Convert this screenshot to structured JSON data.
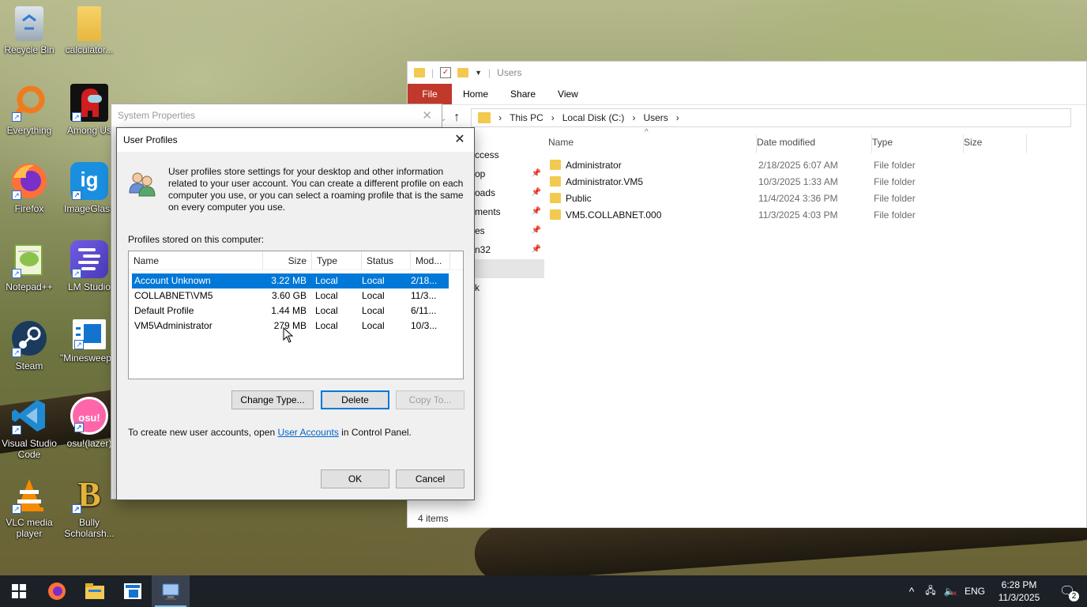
{
  "desktop": {
    "icons": [
      {
        "label": "Recycle Bin"
      },
      {
        "label": "calculator..."
      },
      {
        "label": "Everything"
      },
      {
        "label": "Among Us"
      },
      {
        "label": "Firefox"
      },
      {
        "label": "ImageGlass"
      },
      {
        "label": "Notepad++"
      },
      {
        "label": "LM Studio"
      },
      {
        "label": "Steam"
      },
      {
        "label": "\"Minesweeper"
      },
      {
        "label": "Visual Studio Code"
      },
      {
        "label": "osu!(lazer)"
      },
      {
        "label": "VLC media player"
      },
      {
        "label": "Bully Scholarsh..."
      }
    ]
  },
  "explorer": {
    "title": "Users",
    "tabs": [
      "File",
      "Home",
      "Share",
      "View"
    ],
    "breadcrumb": [
      "This PC",
      "Local Disk (C:)",
      "Users"
    ],
    "nav_items": [
      {
        "label": "ccess",
        "pinned": false
      },
      {
        "label": "op",
        "pinned": true
      },
      {
        "label": "oads",
        "pinned": true
      },
      {
        "label": "ments",
        "pinned": true
      },
      {
        "label": "es",
        "pinned": true
      },
      {
        "label": "n32",
        "pinned": true
      },
      {
        "label": "",
        "pinned": false
      },
      {
        "label": "k",
        "pinned": false
      }
    ],
    "columns": [
      "Name",
      "Date modified",
      "Type",
      "Size"
    ],
    "files": [
      {
        "name": "Administrator",
        "date": "2/18/2025 6:07 AM",
        "type": "File folder"
      },
      {
        "name": "Administrator.VM5",
        "date": "10/3/2025 1:33 AM",
        "type": "File folder"
      },
      {
        "name": "Public",
        "date": "11/4/2024 3:36 PM",
        "type": "File folder"
      },
      {
        "name": "VM5.COLLABNET.000",
        "date": "11/3/2025 4:03 PM",
        "type": "File folder"
      }
    ],
    "status": "4 items"
  },
  "system_properties": {
    "title": "System Properties"
  },
  "user_profiles": {
    "title": "User Profiles",
    "description": "User profiles store settings for your desktop and other information related to your user account. You can create a different profile on each computer you use, or you can select a roaming profile that is the same on every computer you use.",
    "list_label": "Profiles stored on this computer:",
    "columns": [
      "Name",
      "Size",
      "Type",
      "Status",
      "Mod..."
    ],
    "rows": [
      {
        "name": "Account Unknown",
        "size": "3.22 MB",
        "type": "Local",
        "status": "Local",
        "modified": "2/18...",
        "selected": true
      },
      {
        "name": "COLLABNET\\VM5",
        "size": "3.60 GB",
        "type": "Local",
        "status": "Local",
        "modified": "11/3...",
        "selected": false
      },
      {
        "name": "Default Profile",
        "size": "1.44 MB",
        "type": "Local",
        "status": "Local",
        "modified": "6/11...",
        "selected": false
      },
      {
        "name": "VM5\\Administrator",
        "size": "279 MB",
        "type": "Local",
        "status": "Local",
        "modified": "10/3...",
        "selected": false
      }
    ],
    "buttons": {
      "change_type": "Change Type...",
      "delete": "Delete",
      "copy_to": "Copy To...",
      "ok": "OK",
      "cancel": "Cancel"
    },
    "footnote_before": "To create new user accounts, open ",
    "footnote_link": "User Accounts",
    "footnote_after": " in Control Panel."
  },
  "taskbar": {
    "language": "ENG",
    "time": "6:28 PM",
    "date": "11/3/2025",
    "notification_count": "2"
  },
  "colors": {
    "selection": "#0078d7",
    "file_tab": "#c0392b",
    "folder": "#f3c94f",
    "taskbar": "#1c2128"
  }
}
